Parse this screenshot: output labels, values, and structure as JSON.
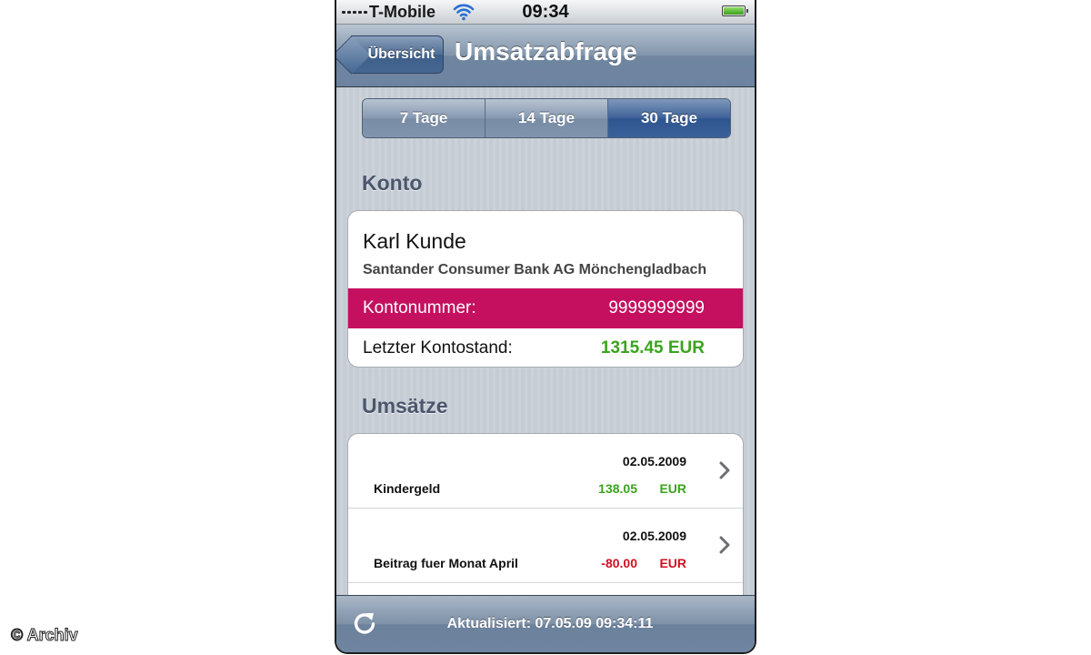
{
  "status_bar": {
    "carrier": "T-Mobile",
    "time": "09:34"
  },
  "nav": {
    "back_label": "Übersicht",
    "title": "Umsatzabfrage"
  },
  "segments": [
    {
      "label": "7 Tage",
      "active": false
    },
    {
      "label": "14 Tage",
      "active": false
    },
    {
      "label": "30 Tage",
      "active": true
    }
  ],
  "account": {
    "section_label": "Konto",
    "holder": "Karl Kunde",
    "bank": "Santander Consumer Bank AG Mönchengladbach",
    "number_label": "Kontonummer:",
    "number_value": "9999999999",
    "balance_label": "Letzter Kontostand:",
    "balance_value": "1315.45 EUR"
  },
  "transactions": {
    "section_label": "Umsätze",
    "items": [
      {
        "date": "02.05.2009",
        "description": "Kindergeld",
        "amount": "138.05",
        "currency": "EUR",
        "sign": "positive"
      },
      {
        "date": "02.05.2009",
        "description": "Beitrag fuer Monat April",
        "amount": "-80.00",
        "currency": "EUR",
        "sign": "negative"
      }
    ]
  },
  "toolbar": {
    "updated_text": "Aktualisiert: 07.05.09 09:34:11"
  },
  "credit": "© Archiv",
  "colors": {
    "accent_magenta": "#c4105f",
    "positive": "#3aa41d",
    "negative": "#d01020",
    "nav_blue": "#6d84a1"
  }
}
